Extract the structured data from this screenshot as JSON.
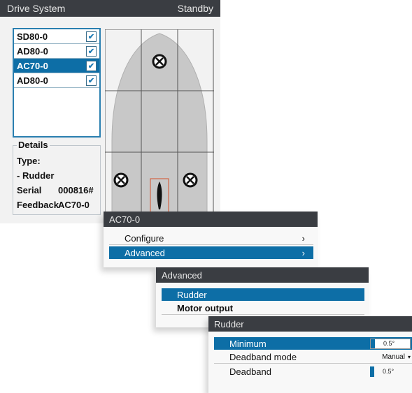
{
  "drive_system": {
    "title": "Drive System",
    "status": "Standby",
    "drives": [
      {
        "label": "SD80-0",
        "checked": true,
        "selected": false
      },
      {
        "label": "AD80-0",
        "checked": true,
        "selected": false
      },
      {
        "label": "AC70-0",
        "checked": true,
        "selected": true
      },
      {
        "label": "AD80-0",
        "checked": true,
        "selected": false
      }
    ],
    "details": {
      "title": "Details",
      "type_label": "Type:",
      "type_value": "- Rudder",
      "serial_label": "Serial",
      "serial_value": "000816#",
      "feedback_label": "Feedback",
      "feedback_value": "AC70-0"
    }
  },
  "ac70_menu": {
    "title": "AC70-0",
    "items": [
      {
        "label": "Configure",
        "arrow": "›",
        "selected": false
      },
      {
        "label": "Advanced",
        "arrow": "›",
        "selected": true
      }
    ]
  },
  "advanced_menu": {
    "title": "Advanced",
    "items": [
      {
        "label": "Rudder",
        "selected": true
      },
      {
        "label": "Motor output",
        "selected": false
      }
    ]
  },
  "rudder_menu": {
    "title": "Rudder",
    "items": [
      {
        "label": "Minimum",
        "value": "0.5°",
        "kind": "slider",
        "fill_fraction": 0.12,
        "selected": true
      },
      {
        "label": "Deadband mode",
        "value": "Manual",
        "kind": "dropdown",
        "selected": false
      },
      {
        "label": "Deadband",
        "value": "0.5°",
        "kind": "slider",
        "fill_fraction": 0.12,
        "selected": false
      }
    ]
  },
  "colors": {
    "titlebar": "#3a3d42",
    "selection": "#0d6ea6",
    "hull": "#c8c8c8"
  },
  "icons": {
    "check": "check-icon",
    "thruster": "thruster-x-icon",
    "arrow": "chevron-right-icon",
    "dropdown": "caret-down-icon"
  }
}
